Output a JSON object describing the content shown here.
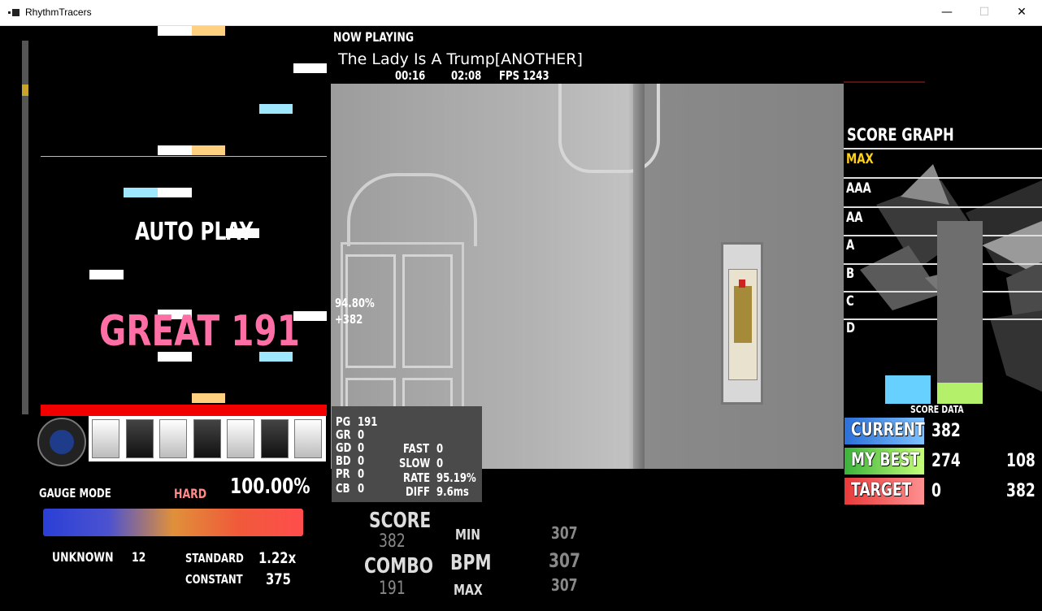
{
  "window": {
    "title": "RhythmTracers",
    "minimize_glyph": "—",
    "maximize_glyph": "☐",
    "close_glyph": "✕"
  },
  "lane": {
    "auto_play": "AUTO PLAY",
    "judgement": "GREAT",
    "judgement_count": "191",
    "song_progress_fraction": 0.12
  },
  "gauge": {
    "mode_label": "GAUGE MODE",
    "mode_value": "HARD",
    "percent": "100.00%",
    "unknown_label": "UNKNOWN",
    "unknown_value": "12",
    "standard_label": "STANDARD",
    "standard_value": "1.22x",
    "constant_label": "CONSTANT",
    "constant_value": "375"
  },
  "now_playing": {
    "label": "NOW PLAYING",
    "song": "The Lady Is A Trump[ANOTHER]",
    "elapsed": "00:16",
    "total": "02:08",
    "fps": "FPS 1243"
  },
  "accuracy": {
    "percent": "94.80%",
    "diff": "+382"
  },
  "judge": {
    "pg_label": "PG",
    "pg": "191",
    "gr_label": "GR",
    "gr": "0",
    "gd_label": "GD",
    "gd": "0",
    "bd_label": "BD",
    "bd": "0",
    "pr_label": "PR",
    "pr": "0",
    "cb_label": "CB",
    "cb": "0",
    "fast_label": "FAST",
    "fast": "0",
    "slow_label": "SLOW",
    "slow": "0",
    "rate_label": "RATE",
    "rate": "95.19%",
    "diff_label": "DIFF",
    "diff": "9.6ms"
  },
  "stats": {
    "score_label": "SCORE",
    "score": "382",
    "combo_label": "COMBO",
    "combo": "191",
    "bpm_label": "BPM",
    "bpm": "307",
    "min_label": "MIN",
    "min": "307",
    "max_label": "MAX",
    "max": "307"
  },
  "score_graph": {
    "title": "SCORE GRAPH",
    "ranks": [
      "MAX",
      "AAA",
      "AA",
      "A",
      "B",
      "C",
      "D"
    ],
    "max_color": "#ffd21a",
    "score_data_label": "SCORE DATA",
    "current_fraction": 0.088,
    "best_fraction": 0.064
  },
  "scores": {
    "current_label": "CURRENT",
    "current": "382",
    "best_label": "MY BEST",
    "best": "274",
    "best_diff": "108",
    "target_label": "TARGET",
    "target": "0",
    "target_diff": "382"
  }
}
